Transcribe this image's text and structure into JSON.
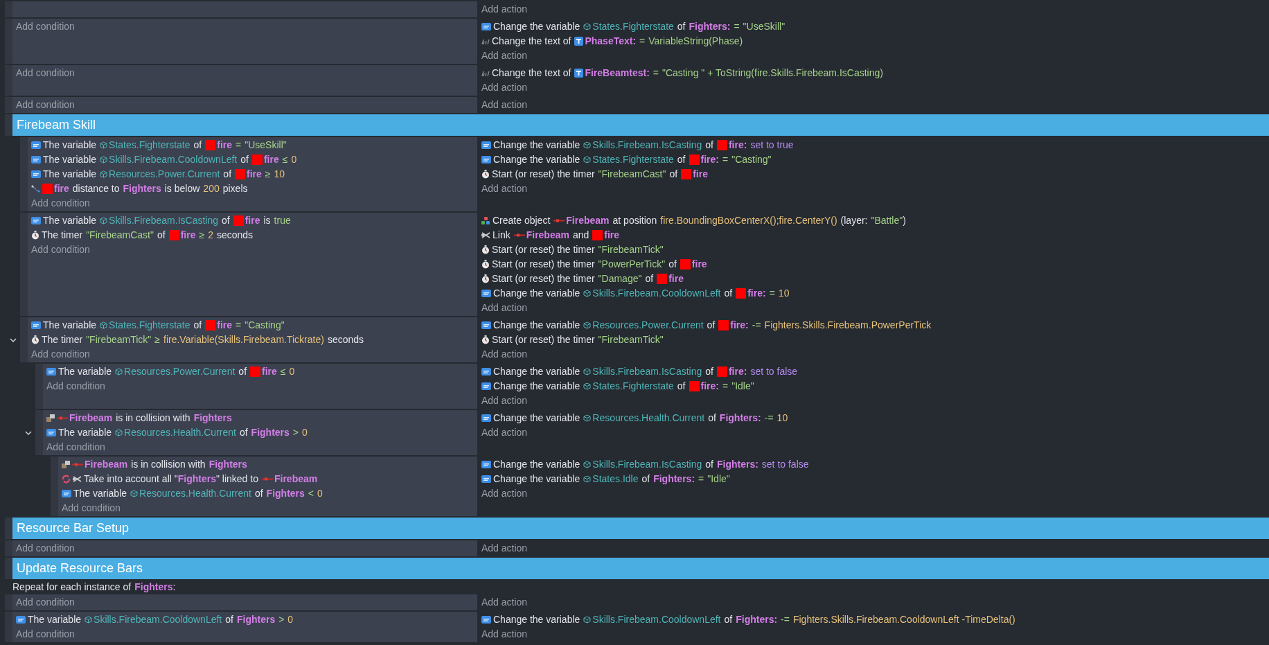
{
  "events": [
    {
      "kind": "event",
      "add_action": "Add action"
    },
    {
      "kind": "event",
      "add_condition": "Add condition",
      "actions": [
        {
          "kind": "variable",
          "parts": [
            {
              "kind": "text",
              "text": "Change the variable"
            },
            {
              "kind": "var",
              "text": "States.Fighterstate"
            },
            {
              "kind": "text",
              "text": "of"
            },
            {
              "kind": "obj",
              "text": "Fighters:"
            },
            {
              "kind": "op",
              "text": "="
            },
            {
              "kind": "str",
              "text": "\"UseSkill\""
            }
          ]
        },
        {
          "kind": "text",
          "parts": [
            {
              "kind": "text",
              "text": "Change the text of"
            },
            {
              "kind": "text-obj",
              "text": "PhaseText:"
            },
            {
              "kind": "op",
              "text": "="
            },
            {
              "kind": "str",
              "text": "VariableString(Phase)"
            }
          ]
        }
      ],
      "add_action": "Add action"
    },
    {
      "kind": "event",
      "add_condition": "Add condition",
      "actions": [
        {
          "kind": "text",
          "parts": [
            {
              "kind": "text",
              "text": "Change the text of"
            },
            {
              "kind": "text-obj",
              "text": "FireBeamtest:"
            },
            {
              "kind": "op",
              "text": "="
            },
            {
              "kind": "str",
              "text": "\"Casting \" + ToString(fire.Skills.Firebeam.IsCasting)"
            }
          ]
        }
      ],
      "add_action": "Add action"
    },
    {
      "kind": "event",
      "add_condition": "Add condition",
      "add_action": "Add action"
    },
    {
      "kind": "group",
      "title": "Firebeam Skill",
      "children": [
        {
          "kind": "event",
          "conditions": [
            {
              "kind": "variable",
              "parts": [
                {
                  "kind": "text",
                  "text": "The variable"
                },
                {
                  "kind": "var",
                  "text": "States.Fighterstate"
                },
                {
                  "kind": "text",
                  "text": "of"
                },
                {
                  "kind": "sprite-obj",
                  "text": "fire"
                },
                {
                  "kind": "op",
                  "text": "="
                },
                {
                  "kind": "str",
                  "text": "\"UseSkill\""
                }
              ]
            },
            {
              "kind": "variable",
              "parts": [
                {
                  "kind": "text",
                  "text": "The variable"
                },
                {
                  "kind": "var",
                  "text": "Skills.Firebeam.CooldownLeft"
                },
                {
                  "kind": "text",
                  "text": "of"
                },
                {
                  "kind": "sprite-obj",
                  "text": "fire"
                },
                {
                  "kind": "op",
                  "text": "≤"
                },
                {
                  "kind": "num",
                  "text": "0"
                }
              ]
            },
            {
              "kind": "variable",
              "parts": [
                {
                  "kind": "text",
                  "text": "The variable"
                },
                {
                  "kind": "var",
                  "text": "Resources.Power.Current"
                },
                {
                  "kind": "text",
                  "text": "of"
                },
                {
                  "kind": "sprite-obj",
                  "text": "fire"
                },
                {
                  "kind": "op",
                  "text": "≥"
                },
                {
                  "kind": "num",
                  "text": "10"
                }
              ]
            },
            {
              "kind": "distance",
              "parts": [
                {
                  "kind": "sprite-obj",
                  "text": "fire"
                },
                {
                  "kind": "text",
                  "text": "distance to"
                },
                {
                  "kind": "obj",
                  "text": "Fighters"
                },
                {
                  "kind": "text",
                  "text": "is below"
                },
                {
                  "kind": "num",
                  "text": "200"
                },
                {
                  "kind": "text",
                  "text": "pixels"
                }
              ]
            }
          ],
          "add_condition": "Add condition",
          "actions": [
            {
              "kind": "variable",
              "parts": [
                {
                  "kind": "text",
                  "text": "Change the variable"
                },
                {
                  "kind": "var",
                  "text": "Skills.Firebeam.IsCasting"
                },
                {
                  "kind": "text",
                  "text": "of"
                },
                {
                  "kind": "sprite-obj",
                  "text": "fire:"
                },
                {
                  "kind": "kw",
                  "text": "set to true"
                }
              ]
            },
            {
              "kind": "variable",
              "parts": [
                {
                  "kind": "text",
                  "text": "Change the variable"
                },
                {
                  "kind": "var",
                  "text": "States.Fighterstate"
                },
                {
                  "kind": "text",
                  "text": "of"
                },
                {
                  "kind": "sprite-obj",
                  "text": "fire:"
                },
                {
                  "kind": "op",
                  "text": "="
                },
                {
                  "kind": "str",
                  "text": "\"Casting\""
                }
              ]
            },
            {
              "kind": "timer",
              "parts": [
                {
                  "kind": "text",
                  "text": "Start (or reset) the timer"
                },
                {
                  "kind": "str",
                  "text": "\"FirebeamCast\""
                },
                {
                  "kind": "text",
                  "text": "of"
                },
                {
                  "kind": "sprite-obj",
                  "text": "fire"
                }
              ]
            }
          ],
          "add_action": "Add action"
        },
        {
          "kind": "event",
          "conditions": [
            {
              "kind": "variable",
              "parts": [
                {
                  "kind": "text",
                  "text": "The variable"
                },
                {
                  "kind": "var",
                  "text": "Skills.Firebeam.IsCasting"
                },
                {
                  "kind": "text",
                  "text": "of"
                },
                {
                  "kind": "sprite-obj",
                  "text": "fire"
                },
                {
                  "kind": "text",
                  "text": "is"
                },
                {
                  "kind": "str",
                  "text": "true"
                }
              ]
            },
            {
              "kind": "timer",
              "parts": [
                {
                  "kind": "text",
                  "text": "The timer"
                },
                {
                  "kind": "str",
                  "text": "\"FirebeamCast\""
                },
                {
                  "kind": "text",
                  "text": "of"
                },
                {
                  "kind": "sprite-obj",
                  "text": "fire"
                },
                {
                  "kind": "op",
                  "text": "≥"
                },
                {
                  "kind": "num",
                  "text": "2"
                },
                {
                  "kind": "text",
                  "text": "seconds"
                }
              ]
            }
          ],
          "add_condition": "Add condition",
          "actions": [
            {
              "kind": "create",
              "parts": [
                {
                  "kind": "text",
                  "text": "Create object"
                },
                {
                  "kind": "beam-obj",
                  "text": "Firebeam"
                },
                {
                  "kind": "text",
                  "text": "at position"
                },
                {
                  "kind": "expr",
                  "text": "fire.BoundingBoxCenterX();fire.CenterY()"
                },
                {
                  "kind": "text",
                  "text": "(layer:"
                },
                {
                  "kind": "str",
                  "text": "\"Battle\""
                },
                {
                  "kind": "text",
                  "text": ")",
                  "tight": true
                }
              ]
            },
            {
              "kind": "link",
              "parts": [
                {
                  "kind": "text",
                  "text": "Link"
                },
                {
                  "kind": "beam-obj",
                  "text": "Firebeam"
                },
                {
                  "kind": "text",
                  "text": "and"
                },
                {
                  "kind": "sprite-obj",
                  "text": "fire"
                }
              ]
            },
            {
              "kind": "timer",
              "parts": [
                {
                  "kind": "text",
                  "text": "Start (or reset) the timer"
                },
                {
                  "kind": "str",
                  "text": "\"FirebeamTick\""
                }
              ]
            },
            {
              "kind": "timer",
              "parts": [
                {
                  "kind": "text",
                  "text": "Start (or reset) the timer"
                },
                {
                  "kind": "str",
                  "text": "\"PowerPerTick\""
                },
                {
                  "kind": "text",
                  "text": "of"
                },
                {
                  "kind": "sprite-obj",
                  "text": "fire"
                }
              ]
            },
            {
              "kind": "timer",
              "parts": [
                {
                  "kind": "text",
                  "text": "Start (or reset) the timer"
                },
                {
                  "kind": "str",
                  "text": "\"Damage\""
                },
                {
                  "kind": "text",
                  "text": "of"
                },
                {
                  "kind": "sprite-obj",
                  "text": "fire"
                }
              ]
            },
            {
              "kind": "variable",
              "parts": [
                {
                  "kind": "text",
                  "text": "Change the variable"
                },
                {
                  "kind": "var",
                  "text": "Skills.Firebeam.CooldownLeft"
                },
                {
                  "kind": "text",
                  "text": "of"
                },
                {
                  "kind": "sprite-obj",
                  "text": "fire:"
                },
                {
                  "kind": "op",
                  "text": "="
                },
                {
                  "kind": "num",
                  "text": "10"
                }
              ]
            }
          ],
          "add_action": "Add action"
        },
        {
          "kind": "event",
          "expanded": true,
          "conditions": [
            {
              "kind": "variable",
              "parts": [
                {
                  "kind": "text",
                  "text": "The variable"
                },
                {
                  "kind": "var",
                  "text": "States.Fighterstate"
                },
                {
                  "kind": "text",
                  "text": "of"
                },
                {
                  "kind": "sprite-obj",
                  "text": "fire"
                },
                {
                  "kind": "op",
                  "text": "="
                },
                {
                  "kind": "str",
                  "text": "\"Casting\""
                }
              ]
            },
            {
              "kind": "timer",
              "parts": [
                {
                  "kind": "text",
                  "text": "The timer"
                },
                {
                  "kind": "str",
                  "text": "\"FirebeamTick\""
                },
                {
                  "kind": "op",
                  "text": "≥"
                },
                {
                  "kind": "expr",
                  "text": "fire.Variable(Skills.Firebeam.Tickrate)"
                },
                {
                  "kind": "text",
                  "text": "seconds"
                }
              ]
            }
          ],
          "add_condition": "Add condition",
          "actions": [
            {
              "kind": "variable",
              "parts": [
                {
                  "kind": "text",
                  "text": "Change the variable"
                },
                {
                  "kind": "var",
                  "text": "Resources.Power.Current"
                },
                {
                  "kind": "text",
                  "text": "of"
                },
                {
                  "kind": "sprite-obj",
                  "text": "fire:"
                },
                {
                  "kind": "op",
                  "text": "-="
                },
                {
                  "kind": "expr",
                  "text": "Fighters.Skills.Firebeam.PowerPerTick"
                }
              ]
            },
            {
              "kind": "timer",
              "parts": [
                {
                  "kind": "text",
                  "text": "Start (or reset) the timer"
                },
                {
                  "kind": "str",
                  "text": "\"FirebeamTick\""
                }
              ]
            }
          ],
          "add_action": "Add action",
          "children": [
            {
              "kind": "event",
              "conditions": [
                {
                  "kind": "variable",
                  "parts": [
                    {
                      "kind": "text",
                      "text": "The variable"
                    },
                    {
                      "kind": "var",
                      "text": "Resources.Power.Current"
                    },
                    {
                      "kind": "text",
                      "text": "of"
                    },
                    {
                      "kind": "sprite-obj",
                      "text": "fire"
                    },
                    {
                      "kind": "op",
                      "text": "≤"
                    },
                    {
                      "kind": "num",
                      "text": "0"
                    }
                  ]
                }
              ],
              "add_condition": "Add condition",
              "actions": [
                {
                  "kind": "variable",
                  "parts": [
                    {
                      "kind": "text",
                      "text": "Change the variable"
                    },
                    {
                      "kind": "var",
                      "text": "Skills.Firebeam.IsCasting"
                    },
                    {
                      "kind": "text",
                      "text": "of"
                    },
                    {
                      "kind": "sprite-obj",
                      "text": "fire:"
                    },
                    {
                      "kind": "kw",
                      "text": "set to false"
                    }
                  ]
                },
                {
                  "kind": "variable",
                  "parts": [
                    {
                      "kind": "text",
                      "text": "Change the variable"
                    },
                    {
                      "kind": "var",
                      "text": "States.Fighterstate"
                    },
                    {
                      "kind": "text",
                      "text": "of"
                    },
                    {
                      "kind": "sprite-obj",
                      "text": "fire:"
                    },
                    {
                      "kind": "op",
                      "text": "="
                    },
                    {
                      "kind": "str",
                      "text": "\"Idle\""
                    }
                  ]
                }
              ],
              "add_action": "Add action"
            },
            {
              "kind": "event",
              "expanded": true,
              "conditions": [
                {
                  "kind": "collision",
                  "parts": [
                    {
                      "kind": "beam-obj",
                      "text": "Firebeam"
                    },
                    {
                      "kind": "text",
                      "text": "is in collision with"
                    },
                    {
                      "kind": "obj",
                      "text": "Fighters"
                    }
                  ]
                },
                {
                  "kind": "variable",
                  "parts": [
                    {
                      "kind": "text",
                      "text": "The variable"
                    },
                    {
                      "kind": "var",
                      "text": "Resources.Health.Current"
                    },
                    {
                      "kind": "text",
                      "text": "of"
                    },
                    {
                      "kind": "obj",
                      "text": "Fighters"
                    },
                    {
                      "kind": "op",
                      "text": ">"
                    },
                    {
                      "kind": "num",
                      "text": "0"
                    }
                  ]
                }
              ],
              "add_condition": "Add condition",
              "actions": [
                {
                  "kind": "variable",
                  "parts": [
                    {
                      "kind": "text",
                      "text": "Change the variable"
                    },
                    {
                      "kind": "var",
                      "text": "Resources.Health.Current"
                    },
                    {
                      "kind": "text",
                      "text": "of"
                    },
                    {
                      "kind": "obj",
                      "text": "Fighters:"
                    },
                    {
                      "kind": "op",
                      "text": "-="
                    },
                    {
                      "kind": "num",
                      "text": "10"
                    }
                  ]
                }
              ],
              "add_action": "Add action",
              "children": [
                {
                  "kind": "event",
                  "conditions": [
                    {
                      "kind": "collision",
                      "parts": [
                        {
                          "kind": "beam-obj",
                          "text": "Firebeam"
                        },
                        {
                          "kind": "text",
                          "text": "is in collision with"
                        },
                        {
                          "kind": "obj",
                          "text": "Fighters"
                        }
                      ]
                    },
                    {
                      "kind": "pick-linked",
                      "parts": [
                        {
                          "kind": "text",
                          "text": "Take into account all \""
                        },
                        {
                          "kind": "obj",
                          "text": "Fighters",
                          "tight": true
                        },
                        {
                          "kind": "text",
                          "text": "\" linked to",
                          "tight": true
                        },
                        {
                          "kind": "beam-obj",
                          "text": "Firebeam"
                        }
                      ]
                    },
                    {
                      "kind": "variable",
                      "parts": [
                        {
                          "kind": "text",
                          "text": "The variable"
                        },
                        {
                          "kind": "var",
                          "text": "Resources.Health.Current"
                        },
                        {
                          "kind": "text",
                          "text": "of"
                        },
                        {
                          "kind": "obj",
                          "text": "Fighters"
                        },
                        {
                          "kind": "op",
                          "text": "<"
                        },
                        {
                          "kind": "num",
                          "text": "0"
                        }
                      ]
                    }
                  ],
                  "add_condition": "Add condition",
                  "actions": [
                    {
                      "kind": "variable",
                      "parts": [
                        {
                          "kind": "text",
                          "text": "Change the variable"
                        },
                        {
                          "kind": "var",
                          "text": "Skills.Firebeam.IsCasting"
                        },
                        {
                          "kind": "text",
                          "text": "of"
                        },
                        {
                          "kind": "obj",
                          "text": "Fighters:"
                        },
                        {
                          "kind": "kw",
                          "text": "set to false"
                        }
                      ]
                    },
                    {
                      "kind": "variable",
                      "parts": [
                        {
                          "kind": "text",
                          "text": "Change the variable"
                        },
                        {
                          "kind": "var",
                          "text": "States.Idle"
                        },
                        {
                          "kind": "text",
                          "text": "of"
                        },
                        {
                          "kind": "obj",
                          "text": "Fighters:"
                        },
                        {
                          "kind": "op",
                          "text": "="
                        },
                        {
                          "kind": "str",
                          "text": "\"Idle\""
                        }
                      ]
                    }
                  ],
                  "add_action": "Add action"
                }
              ]
            }
          ]
        }
      ]
    },
    {
      "kind": "group",
      "title": "Resource Bar Setup"
    },
    {
      "kind": "event",
      "add_condition": "Add condition",
      "add_action": "Add action"
    },
    {
      "kind": "group",
      "title": "Update Resource Bars"
    },
    {
      "kind": "foreach",
      "header": [
        {
          "kind": "text",
          "text": "Repeat for each instance of"
        },
        {
          "kind": "obj",
          "text": "Fighters"
        },
        {
          "kind": "text",
          "text": ":",
          "tight": true
        }
      ],
      "add_condition": "Add condition",
      "add_action": "Add action"
    },
    {
      "kind": "event",
      "conditions": [
        {
          "kind": "variable",
          "parts": [
            {
              "kind": "text",
              "text": "The variable"
            },
            {
              "kind": "var",
              "text": "Skills.Firebeam.CooldownLeft"
            },
            {
              "kind": "text",
              "text": "of"
            },
            {
              "kind": "obj",
              "text": "Fighters"
            },
            {
              "kind": "op",
              "text": ">"
            },
            {
              "kind": "num",
              "text": "0"
            }
          ]
        }
      ],
      "add_condition": "Add condition",
      "actions": [
        {
          "kind": "variable",
          "parts": [
            {
              "kind": "text",
              "text": "Change the variable"
            },
            {
              "kind": "var",
              "text": "Skills.Firebeam.CooldownLeft"
            },
            {
              "kind": "text",
              "text": "of"
            },
            {
              "kind": "obj",
              "text": "Fighters:"
            },
            {
              "kind": "op",
              "text": "-="
            },
            {
              "kind": "expr",
              "text": "Fighters.Skills.Firebeam.CooldownLeft -TimeDelta()"
            }
          ]
        }
      ],
      "add_action": "Add action"
    }
  ]
}
